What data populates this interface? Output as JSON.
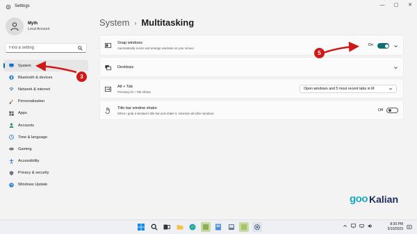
{
  "window": {
    "title": "Settings",
    "minimize_glyph": "—",
    "maximize_glyph": "▢",
    "close_glyph": "✕"
  },
  "profile": {
    "name": "Myth",
    "account": "Local Account"
  },
  "search": {
    "placeholder": "Find a setting"
  },
  "sidebar": {
    "items": [
      {
        "label": "System",
        "icon": "monitor-icon",
        "active": true
      },
      {
        "label": "Bluetooth & devices",
        "icon": "bluetooth-icon"
      },
      {
        "label": "Network & internet",
        "icon": "network-icon"
      },
      {
        "label": "Personalization",
        "icon": "brush-icon"
      },
      {
        "label": "Apps",
        "icon": "apps-icon"
      },
      {
        "label": "Accounts",
        "icon": "person-icon"
      },
      {
        "label": "Time & language",
        "icon": "globe-clock-icon"
      },
      {
        "label": "Gaming",
        "icon": "gamepad-icon"
      },
      {
        "label": "Accessibility",
        "icon": "accessibility-icon"
      },
      {
        "label": "Privacy & security",
        "icon": "shield-icon"
      },
      {
        "label": "Windows Update",
        "icon": "update-icon"
      }
    ]
  },
  "breadcrumb": {
    "parent": "System",
    "separator": "›",
    "current": "Multitasking"
  },
  "settings": {
    "snap": {
      "title": "Snap windows",
      "description": "Automatically resize and arrange windows on your screen",
      "state_label": "On",
      "on": true
    },
    "desktops": {
      "title": "Desktops"
    },
    "alt_tab": {
      "title": "Alt + Tab",
      "description": "Pressing Alt + Tab shows",
      "selected_option": "Open windows and 5 most recent tabs in M"
    },
    "shake": {
      "title": "Title bar window shake",
      "description": "When I grab a window's title bar and shake it, minimize all other windows",
      "state_label": "Off",
      "on": false
    }
  },
  "annotations": [
    {
      "number": "3"
    },
    {
      "number": "5"
    }
  ],
  "watermark": {
    "goo": "goo",
    "kalian": "Kalian"
  },
  "taskbar": {
    "apps": [
      "windows-start-icon",
      "search-icon",
      "task-view-icon",
      "file-explorer-icon",
      "edge-icon",
      "app-icon",
      "app-icon",
      "app-icon",
      "app-icon",
      "settings-icon"
    ],
    "time": "8:30 PM",
    "date": "5/10/2023"
  },
  "colors": {
    "accent": "#0067c0",
    "toggle_on": "#0f6e72",
    "annotation": "#d01818",
    "watermark_blue": "#1aa8c4",
    "watermark_navy": "#1f2a5a"
  }
}
